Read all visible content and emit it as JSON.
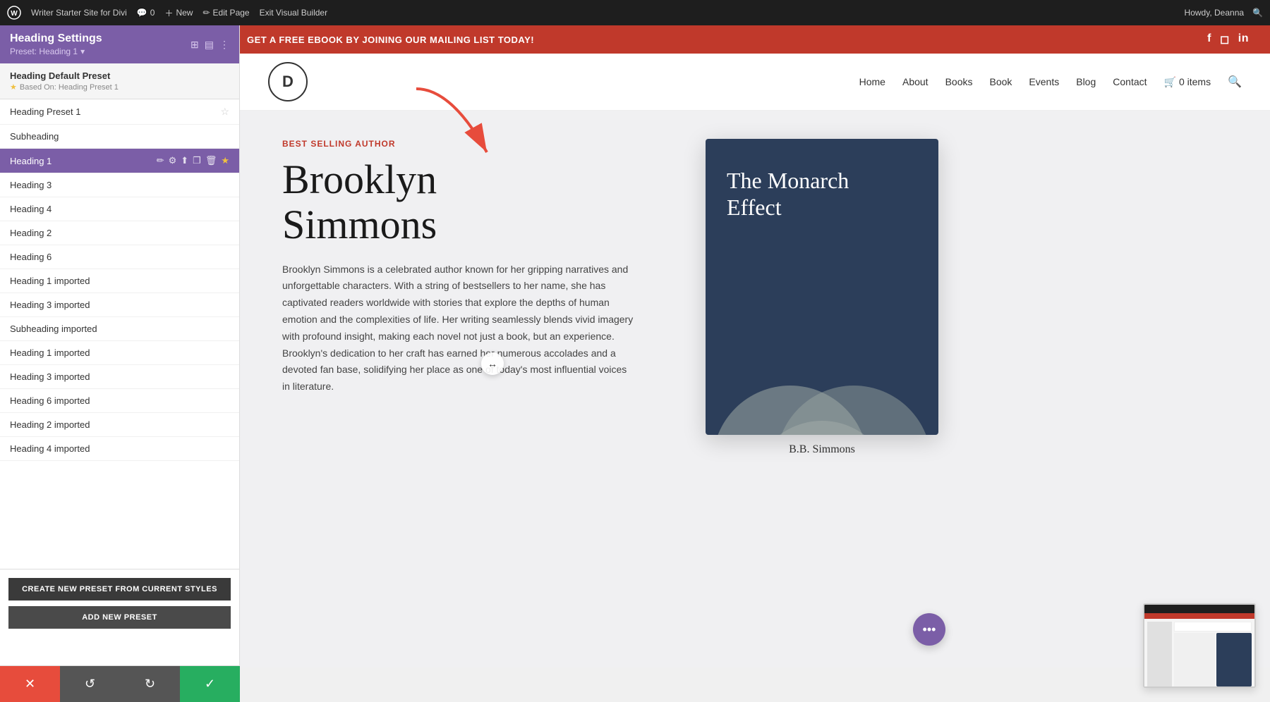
{
  "adminBar": {
    "wpLogoAlt": "WordPress",
    "siteLink": "Writer Starter Site for Divi",
    "commentsCount": "0",
    "newLabel": "New",
    "editPageLabel": "Edit Page",
    "exitBuilderLabel": "Exit Visual Builder",
    "howdyLabel": "Howdy, Deanna",
    "searchIcon": "🔍"
  },
  "topBar": {
    "text": "GET A FREE EBOOK BY JOINING OUR MAILING LIST TODAY!",
    "socialIcons": [
      "facebook",
      "instagram",
      "linkedin"
    ]
  },
  "siteHeader": {
    "logoLetter": "D",
    "navItems": [
      "Home",
      "About",
      "Books",
      "Book",
      "Events",
      "Blog",
      "Contact"
    ],
    "cartLabel": "0 items",
    "searchIcon": "🔍"
  },
  "panel": {
    "title": "Heading Settings",
    "presetLabel": "Preset: Heading 1",
    "presetDropdownIcon": "▾",
    "icons": {
      "windowIcon": "⊞",
      "layoutIcon": "⊟",
      "moreIcon": "⋮"
    },
    "defaultPreset": {
      "name": "Heading Default Preset",
      "basedOn": "Based On: Heading Preset 1",
      "starIcon": "★"
    },
    "presets": [
      {
        "name": "Heading Preset 1",
        "active": false,
        "hasActions": false
      },
      {
        "name": "Subheading",
        "active": false,
        "hasActions": false
      },
      {
        "name": "Heading 1",
        "active": true,
        "hasActions": true
      },
      {
        "name": "Heading 3",
        "active": false,
        "hasActions": false
      },
      {
        "name": "Heading 4",
        "active": false,
        "hasActions": false
      },
      {
        "name": "Heading 2",
        "active": false,
        "hasActions": false
      },
      {
        "name": "Heading 6",
        "active": false,
        "hasActions": false
      },
      {
        "name": "Heading 1 imported",
        "active": false,
        "hasActions": false
      },
      {
        "name": "Heading 3 imported",
        "active": false,
        "hasActions": false
      },
      {
        "name": "Subheading imported",
        "active": false,
        "hasActions": false
      },
      {
        "name": "Heading 1 imported",
        "active": false,
        "hasActions": false
      },
      {
        "name": "Heading 3 imported",
        "active": false,
        "hasActions": false
      },
      {
        "name": "Heading 6 imported",
        "active": false,
        "hasActions": false
      },
      {
        "name": "Heading 2 imported",
        "active": false,
        "hasActions": false
      },
      {
        "name": "Heading 4 imported",
        "active": false,
        "hasActions": false
      }
    ],
    "activeActions": [
      "✏️",
      "⚙",
      "⬆",
      "❐",
      "🗑",
      "★"
    ],
    "createPresetLabel": "CREATE NEW PRESET FROM CURRENT STYLES",
    "addPresetLabel": "ADD NEW PRESET"
  },
  "bottomBar": {
    "cancelIcon": "✕",
    "undoIcon": "↺",
    "redoIcon": "↻",
    "confirmIcon": "✓"
  },
  "siteContent": {
    "bestSellerLabel": "BEST SELLING AUTHOR",
    "authorName": "Brooklyn\nSimmons",
    "authorBio": "Brooklyn Simmons is a celebrated author known for her gripping narratives and unforgettable characters. With a string of bestsellers to her name, she has captivated readers worldwide with stories that explore the depths of human emotion and the complexities of life. Her writing seamlessly blends vivid imagery with profound insight, making each novel not just a book, but an experience. Brooklyn's dedication to her craft has earned her numerous accolades and a devoted fan base, solidifying her place as one of today's most influential voices in literature.",
    "book": {
      "title": "The Monarch Effect",
      "authorLabel": "B.B. Simmons"
    }
  },
  "colors": {
    "purple": "#7b5ea7",
    "red": "#c0392b",
    "darkBlue": "#2c3e5a",
    "adminBarBg": "#1e1e1e",
    "activePresetBg": "#7b5ea7",
    "cancelBtnBg": "#e74c3c",
    "confirmBtnBg": "#27ae60",
    "undoBtnBg": "#555555"
  }
}
